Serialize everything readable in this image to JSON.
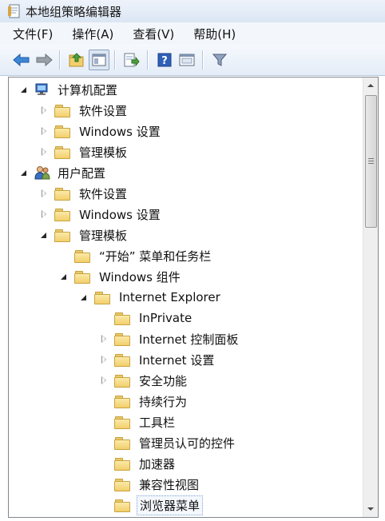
{
  "window": {
    "title": "本地组策略编辑器"
  },
  "menu": [
    {
      "label": "文件(F)",
      "name": "menu-file"
    },
    {
      "label": "操作(A)",
      "name": "menu-action"
    },
    {
      "label": "查看(V)",
      "name": "menu-view"
    },
    {
      "label": "帮助(H)",
      "name": "menu-help"
    }
  ],
  "toolbar": {
    "buttons": [
      "back-arrow-icon",
      "forward-arrow-icon",
      "up-folder-icon",
      "show-hide-tree-icon",
      "export-list-icon",
      "help-icon",
      "properties-icon",
      "filter-icon"
    ]
  },
  "tree": {
    "items": [
      {
        "label": "计算机配置",
        "depth": 0,
        "state": "expanded",
        "icon": "computer-icon"
      },
      {
        "label": "软件设置",
        "depth": 1,
        "state": "collapsed",
        "icon": "folder-icon"
      },
      {
        "label": "Windows 设置",
        "depth": 1,
        "state": "collapsed",
        "icon": "folder-icon"
      },
      {
        "label": "管理模板",
        "depth": 1,
        "state": "collapsed",
        "icon": "folder-icon"
      },
      {
        "label": "用户配置",
        "depth": 0,
        "state": "expanded",
        "icon": "user-icon"
      },
      {
        "label": "软件设置",
        "depth": 1,
        "state": "collapsed",
        "icon": "folder-icon"
      },
      {
        "label": "Windows 设置",
        "depth": 1,
        "state": "collapsed",
        "icon": "folder-icon"
      },
      {
        "label": "管理模板",
        "depth": 1,
        "state": "expanded",
        "icon": "folder-icon"
      },
      {
        "label": "“开始” 菜单和任务栏",
        "depth": 2,
        "state": "leaf",
        "icon": "folder-icon"
      },
      {
        "label": "Windows 组件",
        "depth": 2,
        "state": "expanded",
        "icon": "folder-icon"
      },
      {
        "label": "Internet Explorer",
        "depth": 3,
        "state": "expanded",
        "icon": "folder-icon"
      },
      {
        "label": "InPrivate",
        "depth": 4,
        "state": "leaf",
        "icon": "folder-icon"
      },
      {
        "label": "Internet 控制面板",
        "depth": 4,
        "state": "collapsed",
        "icon": "folder-icon"
      },
      {
        "label": "Internet 设置",
        "depth": 4,
        "state": "collapsed",
        "icon": "folder-icon"
      },
      {
        "label": "安全功能",
        "depth": 4,
        "state": "collapsed",
        "icon": "folder-icon"
      },
      {
        "label": "持续行为",
        "depth": 4,
        "state": "leaf",
        "icon": "folder-icon"
      },
      {
        "label": "工具栏",
        "depth": 4,
        "state": "leaf",
        "icon": "folder-icon"
      },
      {
        "label": "管理员认可的控件",
        "depth": 4,
        "state": "leaf",
        "icon": "folder-icon"
      },
      {
        "label": "加速器",
        "depth": 4,
        "state": "leaf",
        "icon": "folder-icon"
      },
      {
        "label": "兼容性视图",
        "depth": 4,
        "state": "leaf",
        "icon": "folder-icon"
      },
      {
        "label": "浏览器菜单",
        "depth": 4,
        "state": "leaf",
        "icon": "folder-icon",
        "selected": true
      }
    ]
  },
  "colors": {
    "folder": "#f2cf6c",
    "selection_border": "#7da2ce",
    "toolbar_bg": "#e4ecf7"
  }
}
